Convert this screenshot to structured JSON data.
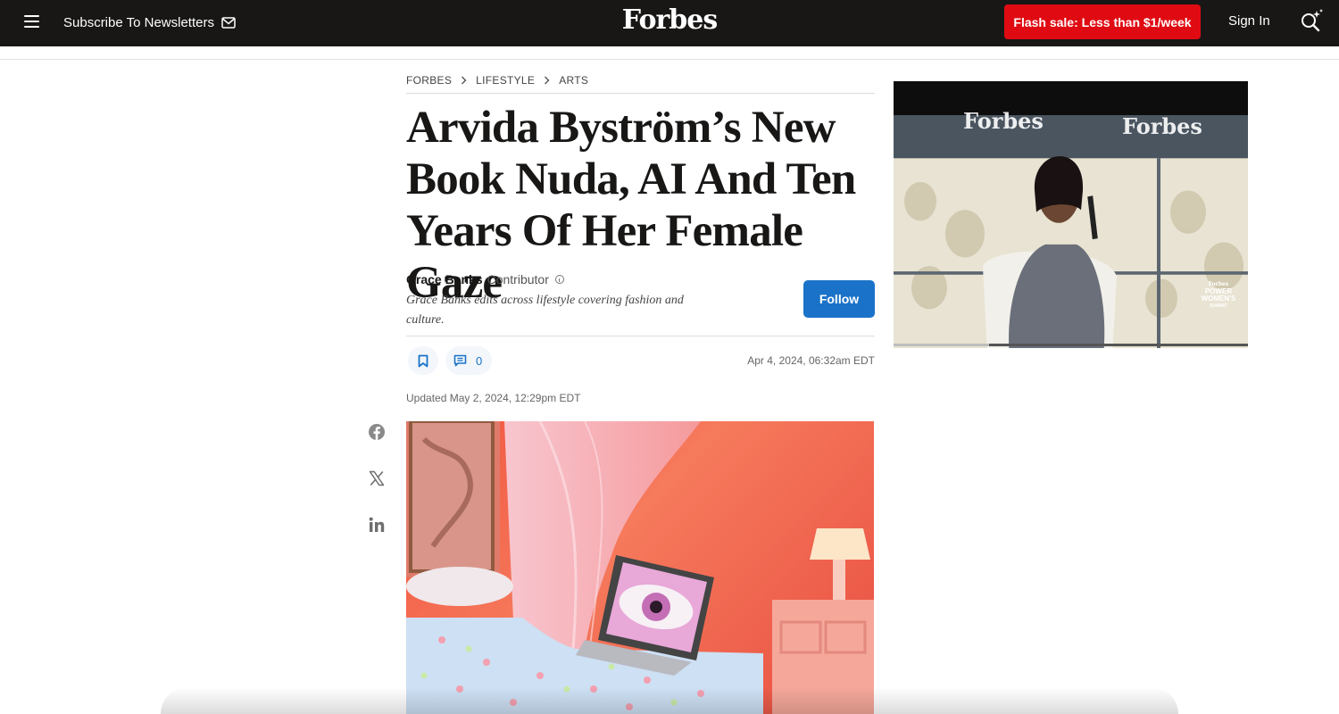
{
  "topbar": {
    "subscribe_label": "Subscribe To Newsletters",
    "logo": "Forbes",
    "flash_sale_label": "Flash sale: Less than $1/week",
    "signin_label": "Sign In",
    "icons": [
      "menu-icon",
      "mail-icon",
      "search-sparkle-icon"
    ]
  },
  "breadcrumb": [
    "FORBES",
    "LIFESTYLE",
    "ARTS"
  ],
  "article": {
    "headline": "Arvida Byström’s New Book Nuda, AI And Ten Years Of Her Female Gaze",
    "author": {
      "name": "Grace Banks",
      "role": "Contributor",
      "bio": "Grace Banks edits across lifestyle covering fashion and culture.",
      "follow_label": "Follow"
    },
    "comment_count": "0",
    "published": "Apr 4, 2024, 06:32am EDT",
    "updated": "Updated May 2, 2024, 12:29pm EDT"
  },
  "share": [
    "facebook-icon",
    "x-icon",
    "linkedin-icon"
  ],
  "video_ad": {
    "banner_text": [
      "Forbes",
      "Forbes"
    ],
    "badge_lines": [
      "Forbes",
      "POWER",
      "WOMEN'S",
      "SUMMIT"
    ],
    "progress": 0.27
  },
  "colors": {
    "topbar_bg": "#181716",
    "flash_red": "#e00b12",
    "follow_blue": "#1a73c8",
    "text": "#181716"
  }
}
